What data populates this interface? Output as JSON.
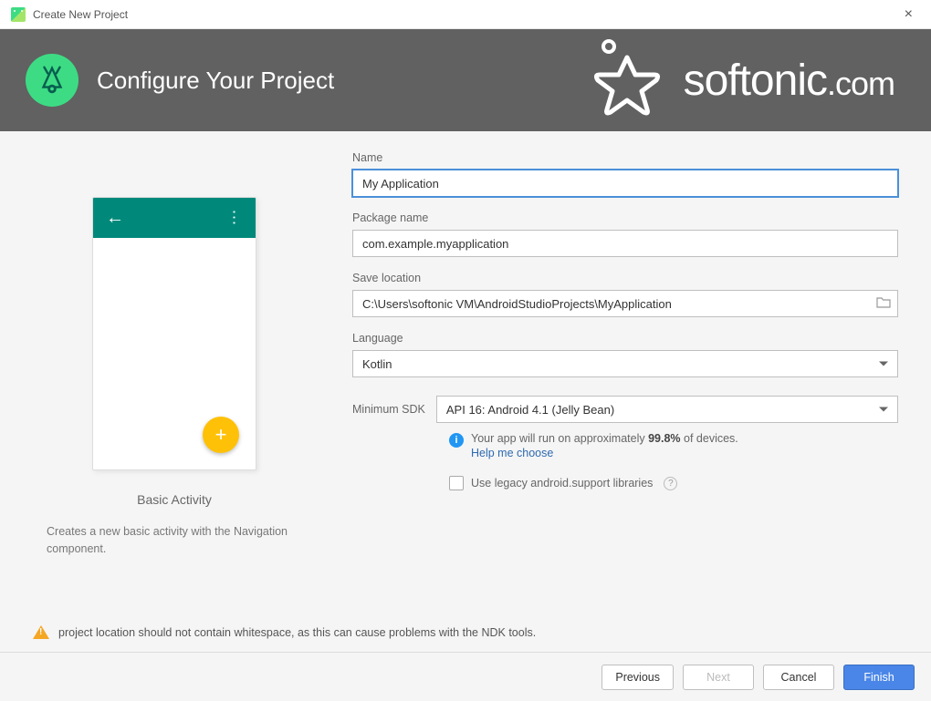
{
  "window": {
    "title": "Create New Project",
    "close": "×"
  },
  "header": {
    "title": "Configure Your Project"
  },
  "watermark": {
    "brand": "softonic",
    "tld": ".com"
  },
  "preview": {
    "title": "Basic Activity",
    "description": "Creates a new basic activity with the Navigation component."
  },
  "form": {
    "name_label": "Name",
    "name_value": "My Application",
    "package_label": "Package name",
    "package_value": "com.example.myapplication",
    "location_label": "Save location",
    "location_value": "C:\\Users\\softonic VM\\AndroidStudioProjects\\MyApplication",
    "language_label": "Language",
    "language_value": "Kotlin",
    "sdk_label": "Minimum SDK",
    "sdk_value": "API 16: Android 4.1 (Jelly Bean)",
    "info_prefix": "Your app will run on approximately ",
    "info_pct": "99.8%",
    "info_suffix": " of devices.",
    "help_link": "Help me choose",
    "legacy_label": "Use legacy android.support libraries"
  },
  "warning": {
    "text": "project location should not contain whitespace, as this can cause problems with the NDK tools."
  },
  "buttons": {
    "previous": "Previous",
    "next": "Next",
    "cancel": "Cancel",
    "finish": "Finish"
  }
}
